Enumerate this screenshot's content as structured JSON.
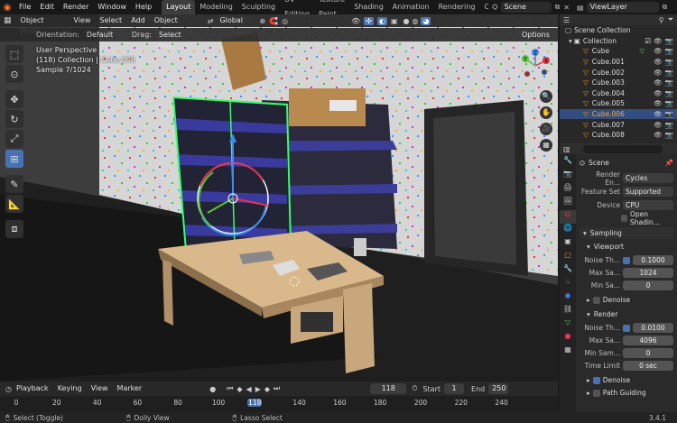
{
  "topbar": {
    "menus": [
      "File",
      "Edit",
      "Render",
      "Window",
      "Help"
    ],
    "workspaces": [
      "Layout",
      "Modeling",
      "Sculpting",
      "UV Editing",
      "Texture Paint",
      "Shading",
      "Animation",
      "Rendering",
      "Compo"
    ],
    "active_workspace": "Layout",
    "scene": "Scene",
    "view_layer": "ViewLayer"
  },
  "viewport_header": {
    "mode": "Object Mode",
    "menus": [
      "View",
      "Select",
      "Add",
      "Object"
    ],
    "transform": "Global",
    "orientation_label": "Orientation:",
    "orientation_value": "Default",
    "drag_label": "Drag:",
    "drag_value": "Select Box",
    "options": "Options"
  },
  "viewport_overlay": {
    "line1": "User Perspective",
    "line2": "(118) Collection | Cube.006",
    "line3": "Sample 7/1024"
  },
  "gizmo_axes": [
    "Y",
    "X",
    "Z"
  ],
  "outliner": {
    "root": "Scene Collection",
    "collection": "Collection",
    "items": [
      "Cube",
      "Cube.001",
      "Cube.002",
      "Cube.003",
      "Cube.004",
      "Cube.005",
      "Cube.006",
      "Cube.007",
      "Cube.008"
    ],
    "selected": "Cube.006"
  },
  "properties": {
    "context": "Scene",
    "render_engine_label": "Render En...",
    "render_engine": "Cycles",
    "feature_set_label": "Feature Set",
    "feature_set": "Supported",
    "device_label": "Device",
    "device": "CPU",
    "open_shading": "Open Shadin...",
    "sampling": "Sampling",
    "viewport": "Viewport",
    "vp_noise_label": "Noise Th...",
    "vp_noise": "0.1000",
    "vp_max_label": "Max Sa...",
    "vp_max": "1024",
    "vp_min_label": "Min Sa...",
    "vp_min": "0",
    "denoise": "Denoise",
    "render": "Render",
    "r_noise_label": "Noise Th...",
    "r_noise": "0.0100",
    "r_max_label": "Max Sa...",
    "r_max": "4096",
    "r_min_label": "Min Sam...",
    "r_min": "0",
    "time_limit_label": "Time Limit",
    "time_limit": "0 sec",
    "r_denoise": "Denoise",
    "path_guiding": "Path Guiding"
  },
  "timeline": {
    "menus": [
      "Playback",
      "Keying",
      "View",
      "Marker"
    ],
    "current_frame": "118",
    "start_label": "Start",
    "start": "1",
    "end_label": "End",
    "end": "250",
    "ruler": [
      "0",
      "20",
      "40",
      "60",
      "80",
      "100",
      "118",
      "140",
      "160",
      "180",
      "200",
      "220",
      "240"
    ]
  },
  "statusbar": {
    "select": "Select (Toggle)",
    "dolly": "Dolly View",
    "lasso": "Lasso Select",
    "version": "3.4.1"
  },
  "colors": {
    "accent": "#4772b3",
    "selection": "#334d80",
    "frame": "#4772b3",
    "outline_active": "#ffaa33"
  }
}
